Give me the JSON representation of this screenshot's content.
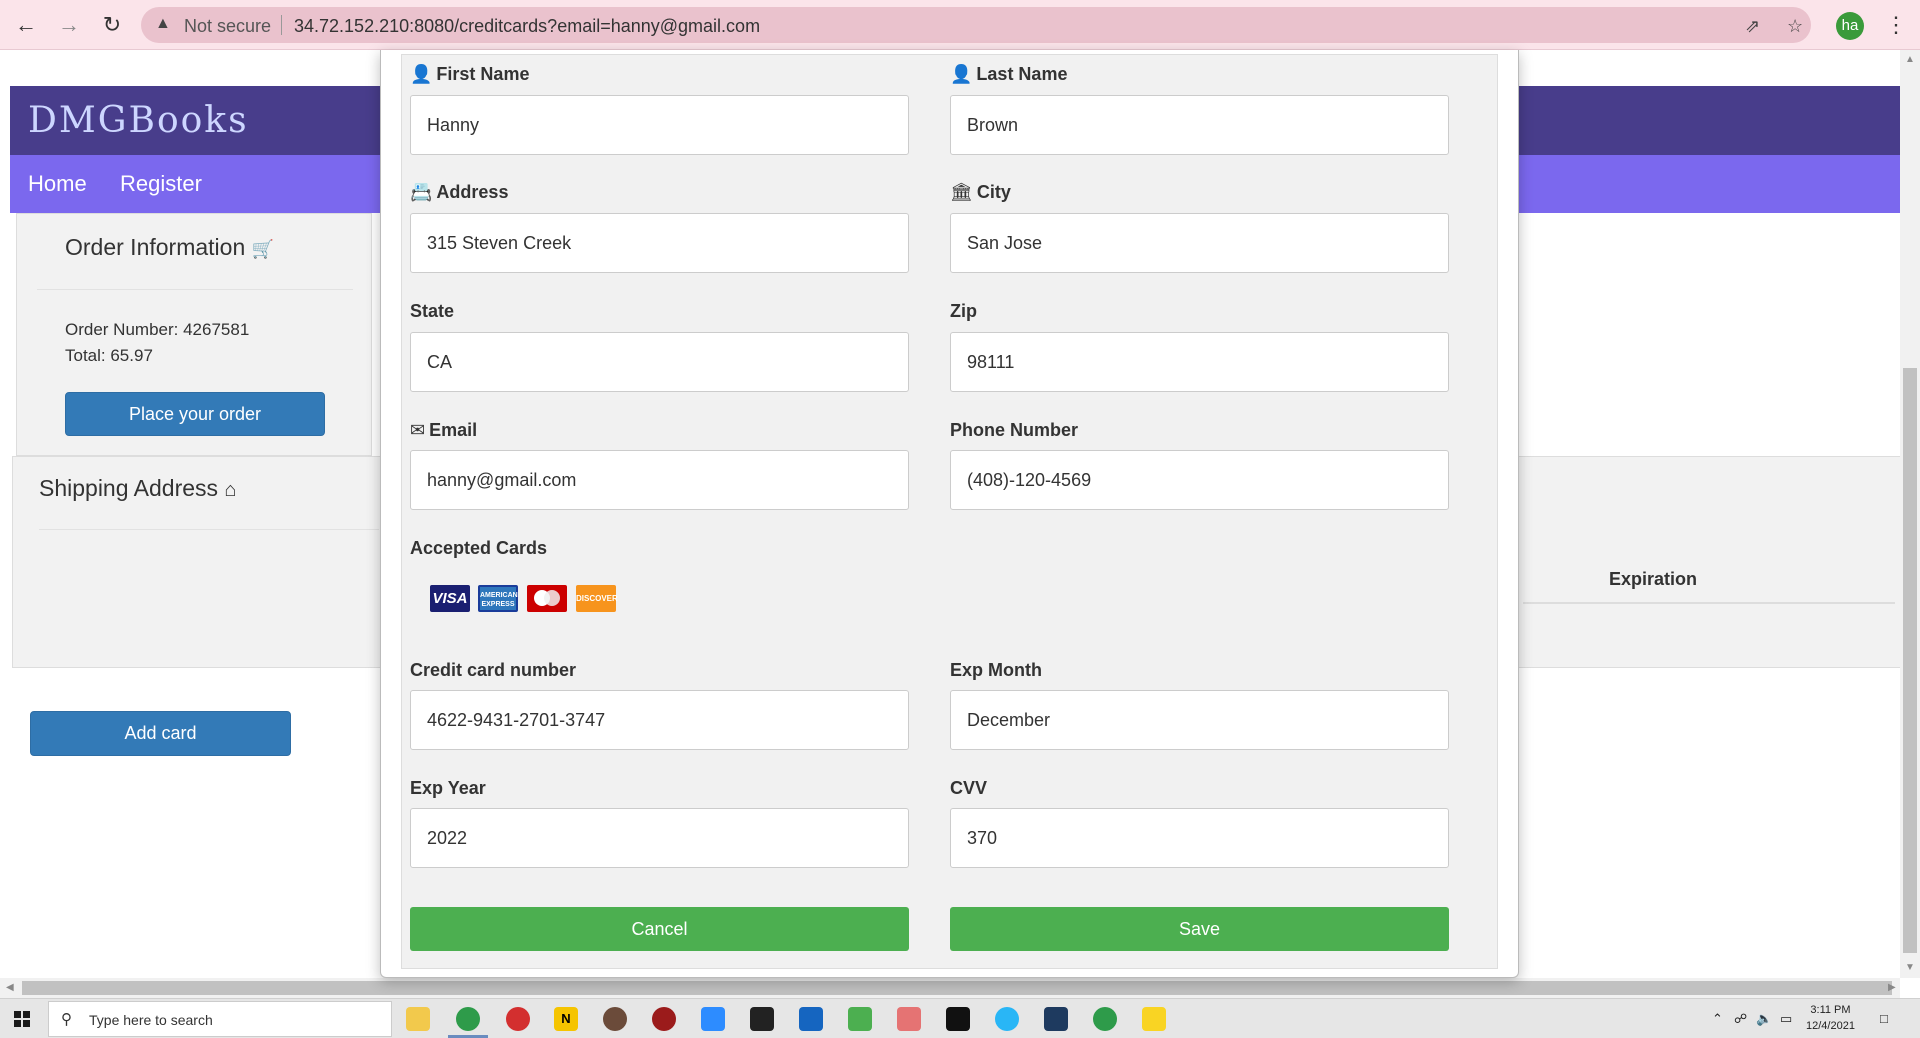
{
  "browser": {
    "not_secure": "Not secure",
    "url": "34.72.152.210:8080/creditcards?email=hanny@gmail.com",
    "profile_initials": "ha"
  },
  "site": {
    "brand": "DMGBooks",
    "nav": [
      "Home",
      "Register"
    ]
  },
  "order": {
    "title": "Order Information",
    "number_line": "Order Number: 4267581",
    "total_line": "Total: 65.97",
    "place_button": "Place your order"
  },
  "shipping": {
    "title": "Shipping Address",
    "expiration_header": "Expiration"
  },
  "add_card_button": "Add card",
  "form": {
    "first_name": {
      "label": "First Name",
      "value": "Hanny"
    },
    "last_name": {
      "label": "Last Name",
      "value": "Brown"
    },
    "address": {
      "label": "Address",
      "value": "315 Steven Creek"
    },
    "city": {
      "label": "City",
      "value": "San Jose"
    },
    "state": {
      "label": "State",
      "value": "CA"
    },
    "zip": {
      "label": "Zip",
      "value": "98111"
    },
    "email": {
      "label": "Email",
      "value": "hanny@gmail.com"
    },
    "phone": {
      "label": "Phone Number",
      "value": "(408)-120-4569"
    },
    "accepted_cards_label": "Accepted Cards",
    "card_logos": {
      "visa": "VISA",
      "amex": "AMERICAN EXPRESS",
      "discover": "DISCOVER"
    },
    "card_number": {
      "label": "Credit card number",
      "value": "4622-9431-2701-3747"
    },
    "exp_month": {
      "label": "Exp Month",
      "value": "December"
    },
    "exp_year": {
      "label": "Exp Year",
      "value": "2022"
    },
    "cvv": {
      "label": "CVV",
      "value": "370"
    },
    "cancel_button": "Cancel",
    "save_button": "Save"
  },
  "taskbar": {
    "search_placeholder": "Type here to search",
    "time": "3:11 PM",
    "date": "12/4/2021"
  },
  "colors": {
    "header_bg": "#483d8b",
    "nav_bg": "#7b68ee",
    "primary_button": "#337ab7",
    "green_button": "#4caf50"
  }
}
